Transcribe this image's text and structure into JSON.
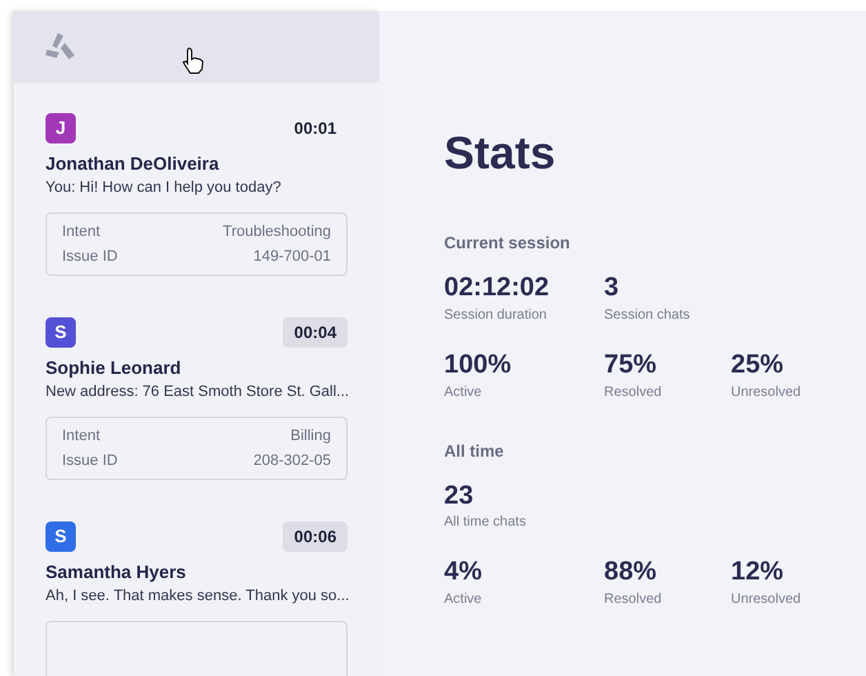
{
  "chats": [
    {
      "initial": "J",
      "color": "#a238b8",
      "timer": "00:01",
      "highlighted": false,
      "name": "Jonathan DeOliveira",
      "preview": "You: Hi! How can I help you today?",
      "details": [
        {
          "label": "Intent",
          "value": "Troubleshooting"
        },
        {
          "label": "Issue ID",
          "value": "149-700-01"
        }
      ]
    },
    {
      "initial": "S",
      "color": "#5551d6",
      "timer": "00:04",
      "highlighted": true,
      "name": "Sophie Leonard",
      "preview": "New address: 76 East Smoth Store St. Gall...",
      "details": [
        {
          "label": "Intent",
          "value": "Billing"
        },
        {
          "label": "Issue ID",
          "value": "208-302-05"
        }
      ]
    },
    {
      "initial": "S",
      "color": "#2f6ee6",
      "timer": "00:06",
      "highlighted": true,
      "name": "Samantha Hyers",
      "preview": "Ah, I see. That makes sense. Thank you so..."
    }
  ],
  "stats": {
    "title": "Stats",
    "sections": [
      {
        "heading": "Current session",
        "rows": [
          [
            {
              "value": "02:12:02",
              "label": "Session duration"
            },
            {
              "value": "3",
              "label": "Session chats"
            }
          ],
          [
            {
              "value": "100%",
              "label": "Active"
            },
            {
              "value": "75%",
              "label": "Resolved"
            },
            {
              "value": "25%",
              "label": "Unresolved"
            }
          ]
        ]
      },
      {
        "heading": "All time",
        "rows": [
          [
            {
              "value": "23",
              "label": "All time chats"
            }
          ],
          [
            {
              "value": "4%",
              "label": "Active"
            },
            {
              "value": "88%",
              "label": "Resolved"
            },
            {
              "value": "12%",
              "label": "Unresolved"
            }
          ]
        ]
      }
    ]
  }
}
